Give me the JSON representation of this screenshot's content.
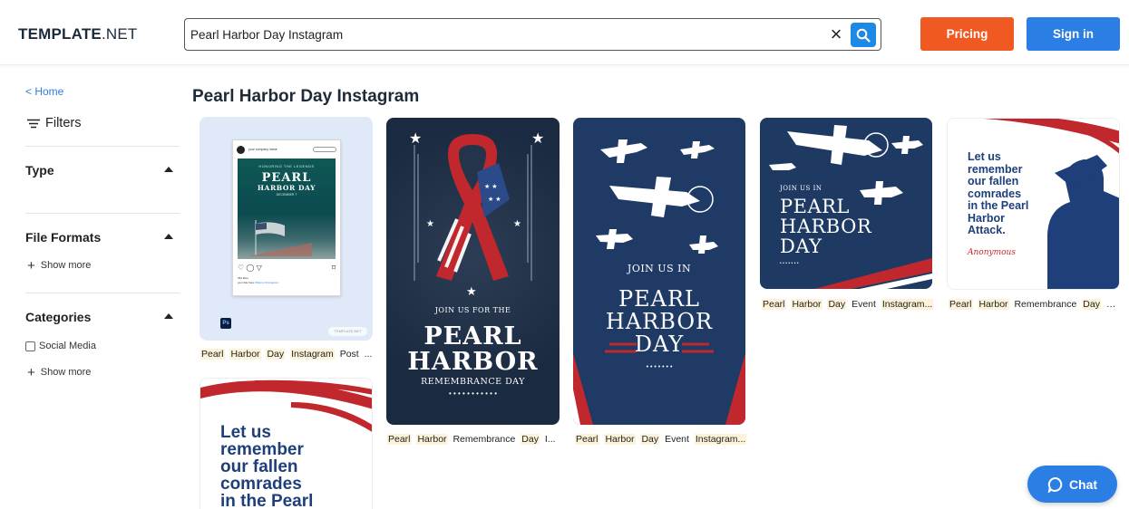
{
  "header": {
    "logo_bold": "TEMPLATE",
    "logo_rest": ".NET",
    "search_value": "Pearl Harbor Day Instagram",
    "pricing_label": "Pricing",
    "signin_label": "Sign in"
  },
  "sidebar": {
    "home_label": "< Home",
    "filters_label": "Filters",
    "type_label": "Type",
    "file_formats_label": "File Formats",
    "show_more_1": "Show more",
    "categories_label": "Categories",
    "social_media_label": "Social Media",
    "show_more_2": "Show more"
  },
  "main": {
    "title": "Pearl Harbor Day Instagram",
    "cards": [
      {
        "caption_parts": [
          "Pearl",
          "Harbor",
          "Day",
          "Instagram",
          "Post ..."
        ],
        "mock": {
          "account": "your company name",
          "line1": "HONORING THE LEGENDS",
          "line2": "PEARL",
          "line3": "HARBOR DAY",
          "line4": "DECEMBER 7",
          "likes": "352 likes",
          "handle": "your title here",
          "tags": "#history  #instagram"
        },
        "badge": "Ps",
        "watermark": "TEMPLATE.NET"
      },
      {
        "caption_parts": [
          "Pearl",
          "Harbor",
          "Remembrance",
          "Day",
          "I..."
        ],
        "join": "JOIN US FOR THE",
        "big1": "PEARL",
        "big2": "HARBOR",
        "sub": "REMEMBRANCE DAY",
        "dots": "• • • • • • • • • • •"
      },
      {
        "caption_parts": [
          "Pearl",
          "Harbor",
          "Day",
          "Event",
          "Instagram..."
        ],
        "join": "JOIN US IN",
        "big1": "PEARL",
        "big2": "HARBOR",
        "big3": "DAY",
        "dots": "• • • • • • •"
      },
      {
        "caption_parts": [
          "Pearl",
          "Harbor",
          "Day",
          "Event",
          "Instagram..."
        ],
        "join": "JOIN US IN",
        "big1": "PEARL",
        "big2": "HARBOR",
        "big3": "DAY",
        "dots": "• • • • • • •"
      },
      {
        "caption_parts": [
          "Pearl",
          "Harbor",
          "Remembrance",
          "Day",
          "Q..."
        ],
        "quote_lines": [
          "Let us",
          "remember",
          "our fallen",
          "comrades",
          "in the Pearl",
          "Harbor",
          "Attack."
        ],
        "signature": "Anonymous"
      },
      {
        "quote_lines": [
          "Let us",
          "remember",
          "our fallen",
          "comrades",
          "in the Pearl"
        ]
      }
    ]
  },
  "chat_label": "Chat",
  "colors": {
    "pricing": "#f05a22",
    "signin": "#2b7ee3",
    "navy": "#1f3a64",
    "red": "#c0282d"
  }
}
